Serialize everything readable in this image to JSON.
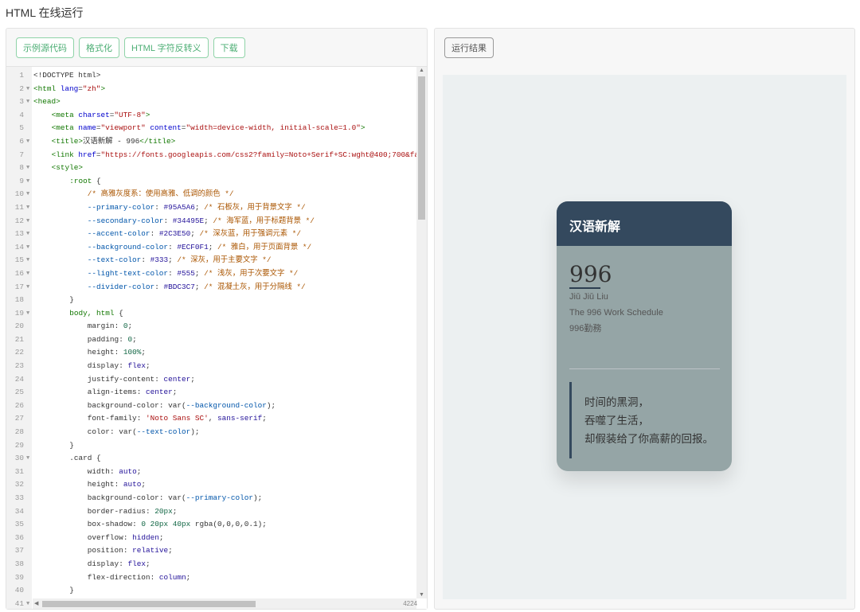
{
  "page_title": "HTML 在线运行",
  "toolbar": {
    "buttons": [
      "示例源代码",
      "格式化",
      "HTML 字符反转义",
      "下载"
    ]
  },
  "result_button": "运行结果",
  "editor": {
    "cursor_position": "4224",
    "lines": [
      {
        "n": 1,
        "i": 0,
        "f": false,
        "s": [
          [
            "plain",
            "<!DOCTYPE html>"
          ]
        ]
      },
      {
        "n": 2,
        "i": 0,
        "f": true,
        "s": [
          [
            "tag",
            "<html "
          ],
          [
            "attr",
            "lang"
          ],
          [
            "plain",
            "="
          ],
          [
            "str",
            "\"zh\""
          ],
          [
            "tag",
            ">"
          ]
        ]
      },
      {
        "n": 3,
        "i": 0,
        "f": true,
        "s": [
          [
            "tag",
            "<head>"
          ]
        ]
      },
      {
        "n": 4,
        "i": 1,
        "f": false,
        "s": [
          [
            "tag",
            "<meta "
          ],
          [
            "attr",
            "charset"
          ],
          [
            "plain",
            "="
          ],
          [
            "str",
            "\"UTF-8\""
          ],
          [
            "tag",
            ">"
          ]
        ]
      },
      {
        "n": 5,
        "i": 1,
        "f": false,
        "s": [
          [
            "tag",
            "<meta "
          ],
          [
            "attr",
            "name"
          ],
          [
            "plain",
            "="
          ],
          [
            "str",
            "\"viewport\" "
          ],
          [
            "attr",
            "content"
          ],
          [
            "plain",
            "="
          ],
          [
            "str",
            "\"width=device-width, initial-scale=1.0\""
          ],
          [
            "tag",
            ">"
          ]
        ]
      },
      {
        "n": 6,
        "i": 1,
        "f": true,
        "s": [
          [
            "tag",
            "<title>"
          ],
          [
            "plain",
            "汉语新解 - 996"
          ],
          [
            "tag",
            "</title>"
          ]
        ]
      },
      {
        "n": 7,
        "i": 1,
        "f": false,
        "s": [
          [
            "tag",
            "<link "
          ],
          [
            "attr",
            "href"
          ],
          [
            "plain",
            "="
          ],
          [
            "str",
            "\"https://fonts.googleapis.com/css2?family=Noto+Serif+SC:wght@400;700&fam"
          ]
        ]
      },
      {
        "n": 8,
        "i": 1,
        "f": true,
        "s": [
          [
            "tag",
            "<style>"
          ]
        ]
      },
      {
        "n": 9,
        "i": 2,
        "f": true,
        "s": [
          [
            "sel",
            ":root "
          ],
          [
            "plain",
            "{"
          ]
        ]
      },
      {
        "n": 10,
        "i": 3,
        "f": true,
        "s": [
          [
            "cmt",
            "/* 高雅灰度系：使用高雅、低调的颜色 */"
          ]
        ]
      },
      {
        "n": 11,
        "i": 3,
        "f": true,
        "s": [
          [
            "var",
            "--primary-color"
          ],
          [
            "plain",
            ": "
          ],
          [
            "val",
            "#95A5A6"
          ],
          [
            "plain",
            "; "
          ],
          [
            "cmt",
            "/* 石板灰，用于背景文字 */"
          ]
        ]
      },
      {
        "n": 12,
        "i": 3,
        "f": true,
        "s": [
          [
            "var",
            "--secondary-color"
          ],
          [
            "plain",
            ": "
          ],
          [
            "val",
            "#34495E"
          ],
          [
            "plain",
            "; "
          ],
          [
            "cmt",
            "/* 海军蓝，用于标题背景 */"
          ]
        ]
      },
      {
        "n": 13,
        "i": 3,
        "f": true,
        "s": [
          [
            "var",
            "--accent-color"
          ],
          [
            "plain",
            ": "
          ],
          [
            "val",
            "#2C3E50"
          ],
          [
            "plain",
            "; "
          ],
          [
            "cmt",
            "/* 深灰蓝，用于强调元素 */"
          ]
        ]
      },
      {
        "n": 14,
        "i": 3,
        "f": true,
        "s": [
          [
            "var",
            "--background-color"
          ],
          [
            "plain",
            ": "
          ],
          [
            "val",
            "#ECF0F1"
          ],
          [
            "plain",
            "; "
          ],
          [
            "cmt",
            "/* 雅白，用于页面背景 */"
          ]
        ]
      },
      {
        "n": 15,
        "i": 3,
        "f": true,
        "s": [
          [
            "var",
            "--text-color"
          ],
          [
            "plain",
            ": "
          ],
          [
            "val",
            "#333"
          ],
          [
            "plain",
            "; "
          ],
          [
            "cmt",
            "/* 深灰，用于主要文字 */"
          ]
        ]
      },
      {
        "n": 16,
        "i": 3,
        "f": true,
        "s": [
          [
            "var",
            "--light-text-color"
          ],
          [
            "plain",
            ": "
          ],
          [
            "val",
            "#555"
          ],
          [
            "plain",
            "; "
          ],
          [
            "cmt",
            "/* 浅灰，用于次要文字 */"
          ]
        ]
      },
      {
        "n": 17,
        "i": 3,
        "f": true,
        "s": [
          [
            "var",
            "--divider-color"
          ],
          [
            "plain",
            ": "
          ],
          [
            "val",
            "#BDC3C7"
          ],
          [
            "plain",
            "; "
          ],
          [
            "cmt",
            "/* 混凝土灰，用于分隔线 */"
          ]
        ]
      },
      {
        "n": 18,
        "i": 2,
        "f": false,
        "s": [
          [
            "plain",
            "}"
          ]
        ]
      },
      {
        "n": 19,
        "i": 2,
        "f": true,
        "s": [
          [
            "sel",
            "body, html "
          ],
          [
            "plain",
            "{"
          ]
        ]
      },
      {
        "n": 20,
        "i": 3,
        "f": false,
        "s": [
          [
            "prop",
            "margin"
          ],
          [
            "plain",
            ": "
          ],
          [
            "num",
            "0"
          ],
          [
            "plain",
            ";"
          ]
        ]
      },
      {
        "n": 21,
        "i": 3,
        "f": false,
        "s": [
          [
            "prop",
            "padding"
          ],
          [
            "plain",
            ": "
          ],
          [
            "num",
            "0"
          ],
          [
            "plain",
            ";"
          ]
        ]
      },
      {
        "n": 22,
        "i": 3,
        "f": false,
        "s": [
          [
            "prop",
            "height"
          ],
          [
            "plain",
            ": "
          ],
          [
            "num",
            "100%"
          ],
          [
            "plain",
            ";"
          ]
        ]
      },
      {
        "n": 23,
        "i": 3,
        "f": false,
        "s": [
          [
            "prop",
            "display"
          ],
          [
            "plain",
            ": "
          ],
          [
            "val",
            "flex"
          ],
          [
            "plain",
            ";"
          ]
        ]
      },
      {
        "n": 24,
        "i": 3,
        "f": false,
        "s": [
          [
            "prop",
            "justify-content"
          ],
          [
            "plain",
            ": "
          ],
          [
            "val",
            "center"
          ],
          [
            "plain",
            ";"
          ]
        ]
      },
      {
        "n": 25,
        "i": 3,
        "f": false,
        "s": [
          [
            "prop",
            "align-items"
          ],
          [
            "plain",
            ": "
          ],
          [
            "val",
            "center"
          ],
          [
            "plain",
            ";"
          ]
        ]
      },
      {
        "n": 26,
        "i": 3,
        "f": false,
        "s": [
          [
            "prop",
            "background-color"
          ],
          [
            "plain",
            ": var("
          ],
          [
            "var",
            "--background-color"
          ],
          [
            "plain",
            ");"
          ]
        ]
      },
      {
        "n": 27,
        "i": 3,
        "f": false,
        "s": [
          [
            "prop",
            "font-family"
          ],
          [
            "plain",
            ": "
          ],
          [
            "str",
            "'Noto Sans SC'"
          ],
          [
            "plain",
            ", "
          ],
          [
            "val",
            "sans-serif"
          ],
          [
            "plain",
            ";"
          ]
        ]
      },
      {
        "n": 28,
        "i": 3,
        "f": false,
        "s": [
          [
            "prop",
            "color"
          ],
          [
            "plain",
            ": var("
          ],
          [
            "var",
            "--text-color"
          ],
          [
            "plain",
            ");"
          ]
        ]
      },
      {
        "n": 29,
        "i": 2,
        "f": false,
        "s": [
          [
            "plain",
            "}"
          ]
        ]
      },
      {
        "n": 30,
        "i": 2,
        "f": true,
        "s": [
          [
            "plain",
            ".card {"
          ]
        ]
      },
      {
        "n": 31,
        "i": 3,
        "f": false,
        "s": [
          [
            "prop",
            "width"
          ],
          [
            "plain",
            ": "
          ],
          [
            "val",
            "auto"
          ],
          [
            "plain",
            ";"
          ]
        ]
      },
      {
        "n": 32,
        "i": 3,
        "f": false,
        "s": [
          [
            "prop",
            "height"
          ],
          [
            "plain",
            ": "
          ],
          [
            "val",
            "auto"
          ],
          [
            "plain",
            ";"
          ]
        ]
      },
      {
        "n": 33,
        "i": 3,
        "f": false,
        "s": [
          [
            "prop",
            "background-color"
          ],
          [
            "plain",
            ": var("
          ],
          [
            "var",
            "--primary-color"
          ],
          [
            "plain",
            ");"
          ]
        ]
      },
      {
        "n": 34,
        "i": 3,
        "f": false,
        "s": [
          [
            "prop",
            "border-radius"
          ],
          [
            "plain",
            ": "
          ],
          [
            "num",
            "20px"
          ],
          [
            "plain",
            ";"
          ]
        ]
      },
      {
        "n": 35,
        "i": 3,
        "f": false,
        "s": [
          [
            "prop",
            "box-shadow"
          ],
          [
            "plain",
            ": "
          ],
          [
            "num",
            "0 20px 40px "
          ],
          [
            "plain",
            "rgba(0,0,0,0.1);"
          ]
        ]
      },
      {
        "n": 36,
        "i": 3,
        "f": false,
        "s": [
          [
            "prop",
            "overflow"
          ],
          [
            "plain",
            ": "
          ],
          [
            "val",
            "hidden"
          ],
          [
            "plain",
            ";"
          ]
        ]
      },
      {
        "n": 37,
        "i": 3,
        "f": false,
        "s": [
          [
            "prop",
            "position"
          ],
          [
            "plain",
            ": "
          ],
          [
            "val",
            "relative"
          ],
          [
            "plain",
            ";"
          ]
        ]
      },
      {
        "n": 38,
        "i": 3,
        "f": false,
        "s": [
          [
            "prop",
            "display"
          ],
          [
            "plain",
            ": "
          ],
          [
            "val",
            "flex"
          ],
          [
            "plain",
            ";"
          ]
        ]
      },
      {
        "n": 39,
        "i": 3,
        "f": false,
        "s": [
          [
            "prop",
            "flex-direction"
          ],
          [
            "plain",
            ": "
          ],
          [
            "val",
            "column"
          ],
          [
            "plain",
            ";"
          ]
        ]
      },
      {
        "n": 40,
        "i": 2,
        "f": false,
        "s": [
          [
            "plain",
            "}"
          ]
        ]
      },
      {
        "n": 41,
        "i": 2,
        "f": true,
        "s": []
      }
    ]
  },
  "card": {
    "header": "汉语新解",
    "word": "996",
    "pinyin": "Jiǔ Jiǔ Liu",
    "english": "The 996 Work Schedule",
    "japanese": "996勤務",
    "quote": [
      "时间的黑洞，",
      "吞噬了生活，",
      "却假装给了你高薪的回报。"
    ],
    "colors": {
      "primary": "#95A5A6",
      "secondary": "#34495E",
      "accent": "#2C3E50",
      "background": "#ECF0F1",
      "divider": "#BDC3C7"
    }
  }
}
